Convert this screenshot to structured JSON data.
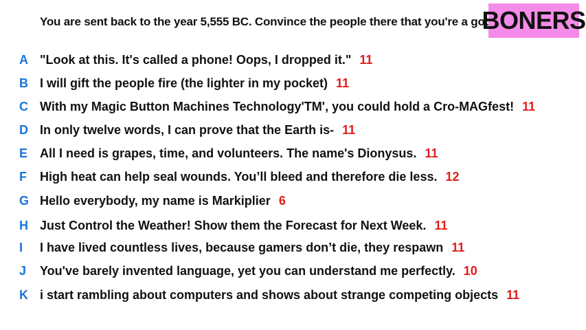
{
  "prompt": "You are sent back to the year 5,555 BC. Convince the people there that you're a god.",
  "badge": "BONERS",
  "answers": [
    {
      "letter": "A",
      "text": "\"Look at this. It's called a phone! Oops, I dropped it.\"",
      "score": "11"
    },
    {
      "letter": "B",
      "text": "I will gift the people fire (the lighter in my pocket)",
      "score": "11"
    },
    {
      "letter": "C",
      "text": "With my Magic Button Machines Technology'TM', you could hold a Cro-MAGfest!",
      "score": "11"
    },
    {
      "letter": "D",
      "text": "In only twelve words, I can prove that the Earth is-",
      "score": "11"
    },
    {
      "letter": "E",
      "text": "All I need is grapes, time, and volunteers. The name's Dionysus.",
      "score": "11"
    },
    {
      "letter": "F",
      "text": "High heat can help seal wounds. You’ll bleed and therefore die less.",
      "score": "12"
    },
    {
      "letter": "G",
      "text": "Hello everybody, my name is Markiplier",
      "score": "6"
    },
    {
      "letter": "H",
      "text": "Just Control the Weather! Show them the Forecast for Next Week.",
      "score": "11"
    },
    {
      "letter": "I",
      "text": "I have lived countless lives, because gamers don’t die, they respawn",
      "score": "11"
    },
    {
      "letter": "J",
      "text": "You've barely invented language, yet you can understand me perfectly.",
      "score": "10"
    },
    {
      "letter": "K",
      "text": "i start rambling about computers and shows about strange competing objects",
      "score": "11"
    }
  ]
}
